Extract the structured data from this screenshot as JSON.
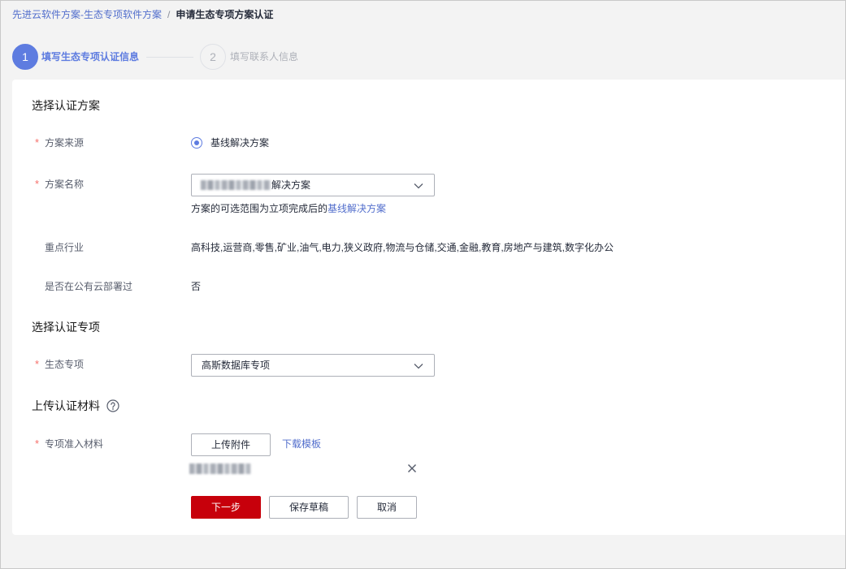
{
  "breadcrumb": {
    "parent": "先进云软件方案-生态专项软件方案",
    "separator": "/",
    "current": "申请生态专项方案认证"
  },
  "steps": [
    {
      "number": "1",
      "label": "填写生态专项认证信息",
      "active": true
    },
    {
      "number": "2",
      "label": "填写联系人信息",
      "active": false
    }
  ],
  "scheme_section": {
    "title": "选择认证方案",
    "source": {
      "required_mark": "*",
      "label": "方案来源",
      "option_label": "基线解决方案",
      "checked": true
    },
    "name": {
      "required_mark": "*",
      "label": "方案名称",
      "selected_value": "解决方案",
      "hint_text": "方案的可选范围为立项完成后的",
      "hint_link": "基线解决方案"
    },
    "industry": {
      "label": "重点行业",
      "value": "高科技,运营商,零售,矿业,油气,电力,狭义政府,物流与仓储,交通,金融,教育,房地产与建筑,数字化办公"
    },
    "public_cloud": {
      "label": "是否在公有云部署过",
      "value": "否"
    }
  },
  "special_section": {
    "title": "选择认证专项",
    "eco_special": {
      "required_mark": "*",
      "label": "生态专项",
      "selected_value": "高斯数据库专项"
    }
  },
  "upload_section": {
    "title": "上传认证材料",
    "material": {
      "required_mark": "*",
      "label": "专项准入材料",
      "upload_button": "上传附件",
      "template_link": "下载模板"
    }
  },
  "actions": {
    "next": "下一步",
    "save_draft": "保存草稿",
    "cancel": "取消"
  },
  "icons": {
    "help": "question-circle-icon",
    "select_arrow": "chevron-down-icon",
    "remove_file": "close-icon",
    "radio": "radio-checked-icon"
  },
  "colors": {
    "brand_blue": "#5e7ce0",
    "link": "#526ecc",
    "primary_button": "#c7000b",
    "required": "#f66f6a",
    "page_background": "#f3f3f3"
  }
}
